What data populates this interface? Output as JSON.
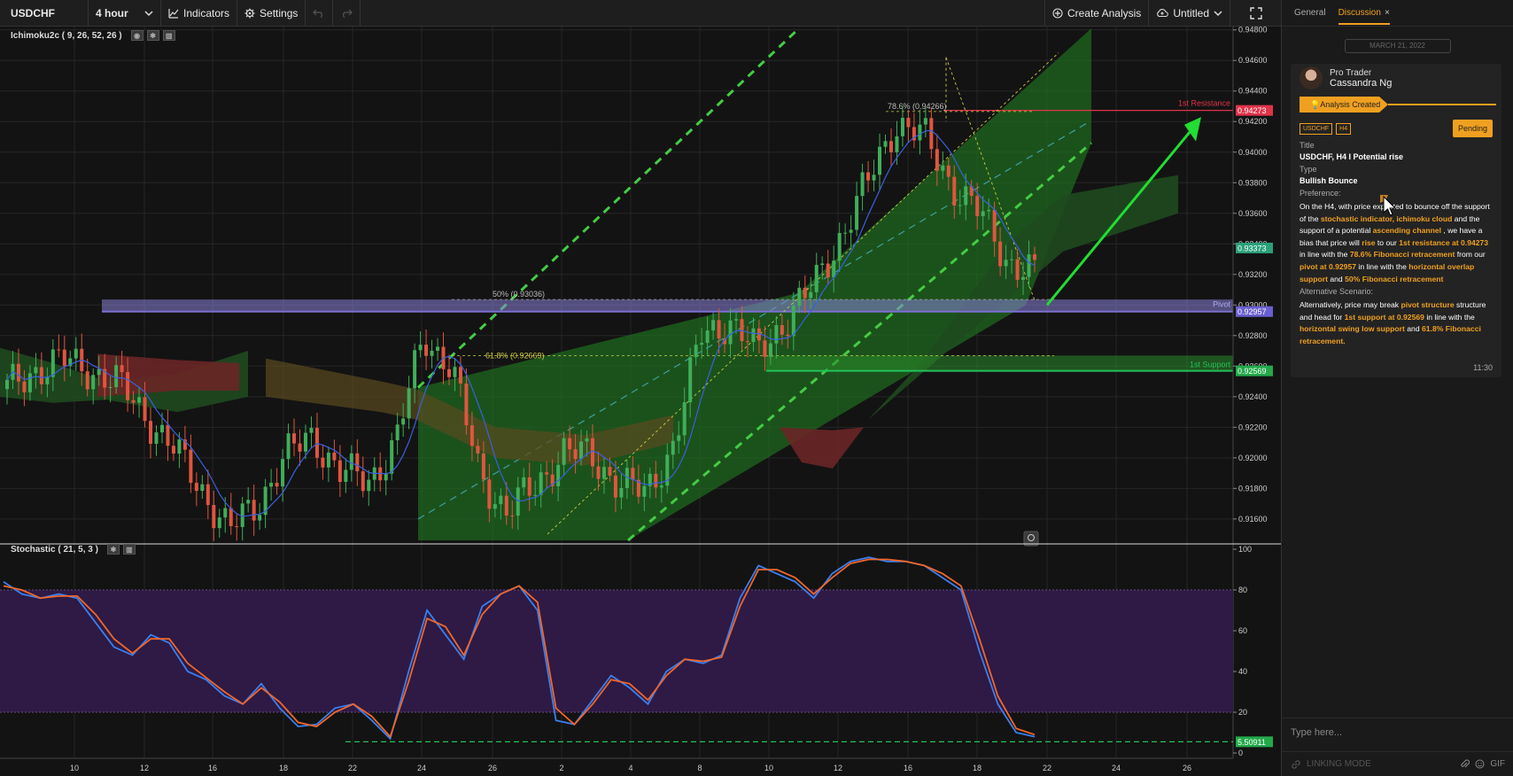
{
  "toolbar": {
    "symbol": "USDCHF",
    "interval": "4 hour",
    "indicators": "Indicators",
    "settings": "Settings",
    "create_analysis": "Create Analysis",
    "untitled": "Untitled"
  },
  "indicators": {
    "ichimoku": "Ichimoku2c ( 9, 26, 52, 26 )",
    "stochastic": "Stochastic ( 21, 5, 3 )"
  },
  "chart_data": [
    {
      "type": "candlestick",
      "symbol": "USDCHF",
      "interval": "4 hour",
      "x_ticks": [
        "10",
        "12",
        "16",
        "18",
        "22",
        "24",
        "26",
        "2",
        "4",
        "8",
        "10",
        "12",
        "16",
        "18",
        "22",
        "24",
        "26"
      ],
      "y_ticks": [
        "0.94800",
        "0.94600",
        "0.94400",
        "0.94200",
        "0.94000",
        "0.93800",
        "0.93600",
        "0.93400",
        "0.93200",
        "0.93000",
        "0.92800",
        "0.92600",
        "0.92400",
        "0.92200",
        "0.92000",
        "0.91800",
        "0.91600"
      ],
      "ylim": [
        0.9146,
        0.9481
      ],
      "price_close_approx": [
        0.9245,
        0.9258,
        0.9263,
        0.9258,
        0.9248,
        0.9228,
        0.9205,
        0.918,
        0.9152,
        0.917,
        0.92,
        0.9215,
        0.919,
        0.9185,
        0.921,
        0.928,
        0.926,
        0.919,
        0.9165,
        0.918,
        0.9205,
        0.92,
        0.9185,
        0.9175,
        0.921,
        0.928,
        0.929,
        0.9268,
        0.929,
        0.931,
        0.9345,
        0.938,
        0.942,
        0.941,
        0.938,
        0.936,
        0.933,
        0.932
      ],
      "levels": [
        {
          "label": "1st Resistance",
          "value": "0.94273",
          "color": "#e0334a"
        },
        {
          "label": "Pivot",
          "value": "0.92957",
          "color": "#7b6fd0"
        },
        {
          "label": "1st Support",
          "value": "0.92569",
          "color": "#22c25a"
        }
      ],
      "current_price": "0.93373",
      "fib_labels": [
        "78.6% (0.94266)",
        "50% (0.93036)",
        "61.8% (0.92669)"
      ]
    },
    {
      "type": "line",
      "title": "Stochastic ( 21, 5, 3 )",
      "y_ticks": [
        "100",
        "80",
        "60",
        "40",
        "20",
        "0"
      ],
      "ylim": [
        0,
        100
      ],
      "series": [
        {
          "color": "#3a7ff0",
          "values": [
            84,
            78,
            76,
            78,
            76,
            64,
            52,
            48,
            58,
            54,
            40,
            36,
            28,
            24,
            34,
            22,
            13,
            14,
            22,
            24,
            16,
            7,
            40,
            70,
            58,
            46,
            72,
            78,
            82,
            70,
            16,
            14,
            26,
            38,
            32,
            24,
            40,
            46,
            44,
            48,
            76,
            92,
            88,
            84,
            76,
            88,
            94,
            96,
            94,
            94,
            92,
            86,
            80,
            50,
            24,
            10,
            8
          ]
        },
        {
          "color": "#f0662a",
          "values": [
            82,
            80,
            76,
            77,
            77,
            68,
            56,
            49,
            56,
            56,
            44,
            37,
            30,
            24,
            32,
            25,
            15,
            13,
            20,
            24,
            18,
            8,
            35,
            66,
            62,
            48,
            68,
            78,
            82,
            74,
            22,
            14,
            24,
            36,
            34,
            26,
            38,
            46,
            45,
            47,
            72,
            90,
            90,
            86,
            78,
            86,
            93,
            95,
            95,
            94,
            92,
            88,
            82,
            56,
            28,
            12,
            9
          ]
        }
      ],
      "overbought": 80,
      "oversold": 20,
      "current_value": "5.50911"
    }
  ],
  "side_panel": {
    "tab_general": "General",
    "tab_discussion": "Discussion",
    "tab_close": "×",
    "date": "MARCH 21, 2022",
    "author_role": "Pro Trader",
    "author_name": "Cassandra Ng",
    "status": "Analysis Created",
    "tag_symbol": "USDCHF",
    "tag_interval": "H4",
    "pending": "Pending",
    "title_label": "Title",
    "title": "USDCHF, H4 I Potential rise",
    "type_label": "Type",
    "type": "Bullish Bounce",
    "preference_label": "Preference:",
    "pref": [
      {
        "t": "On the H4, with price expected to bounce off the support of the ",
        "h": false
      },
      {
        "t": "stochastic indicator, ichimoku cloud",
        "h": true
      },
      {
        "t": " and the support of a potential ",
        "h": false
      },
      {
        "t": "ascending channel",
        "h": true
      },
      {
        "t": " , we have a bias that price will ",
        "h": false
      },
      {
        "t": "rise",
        "h": true
      },
      {
        "t": " to our ",
        "h": false
      },
      {
        "t": "1st resistance at 0.94273",
        "h": true
      },
      {
        "t": " in line with the ",
        "h": false
      },
      {
        "t": "78.6% Fibonacci retracement",
        "h": true
      },
      {
        "t": " from our ",
        "h": false
      },
      {
        "t": "pivot at 0.92957",
        "h": true
      },
      {
        "t": "  in line with the ",
        "h": false
      },
      {
        "t": "horizontal overlap support",
        "h": true
      },
      {
        "t": " and ",
        "h": false
      },
      {
        "t": "50% Fibonacci retracement",
        "h": true
      }
    ],
    "alt_label": "Alternative Scenario:",
    "alt": [
      {
        "t": "Alternatively, price may break ",
        "h": false
      },
      {
        "t": "pivot structure",
        "h": true
      },
      {
        "t": " structure and head for ",
        "h": false
      },
      {
        "t": "1st support at 0.92569",
        "h": true
      },
      {
        "t": " in line with the ",
        "h": false
      },
      {
        "t": "horizontal swing low support",
        "h": true
      },
      {
        "t": " and ",
        "h": false
      },
      {
        "t": "61.8% Fibonacci retracement.",
        "h": true
      }
    ],
    "time": "11:30",
    "composer_placeholder": "Type here...",
    "linking_mode": "LINKING MODE",
    "gif": "GIF"
  }
}
